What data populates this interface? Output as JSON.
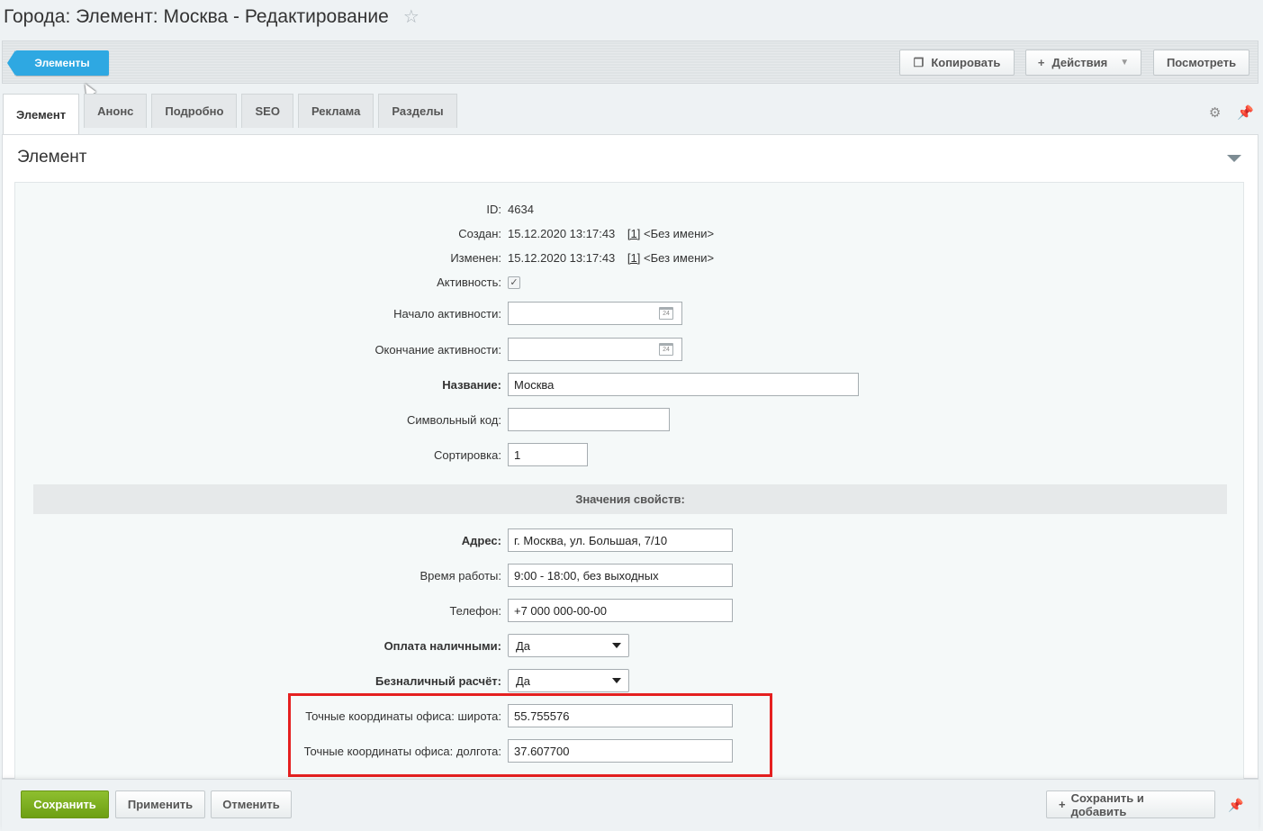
{
  "header": {
    "title": "Города: Элемент: Москва - Редактирование"
  },
  "toolbar": {
    "back_label": "Элементы",
    "copy_label": "Копировать",
    "actions_label": "Действия",
    "view_label": "Посмотреть"
  },
  "tabs": [
    {
      "label": "Элемент",
      "active": true
    },
    {
      "label": "Анонс"
    },
    {
      "label": "Подробно"
    },
    {
      "label": "SEO"
    },
    {
      "label": "Реклама"
    },
    {
      "label": "Разделы"
    }
  ],
  "section": {
    "title": "Элемент"
  },
  "fields": {
    "id": {
      "label": "ID:",
      "value": "4634"
    },
    "created": {
      "label": "Создан:",
      "value": "15.12.2020 13:17:43",
      "user_id": "[1]",
      "user_name": "<Без имени>"
    },
    "modified": {
      "label": "Изменен:",
      "value": "15.12.2020 13:17:43",
      "user_id": "[1]",
      "user_name": "<Без имени>"
    },
    "active": {
      "label": "Активность:",
      "checked": true
    },
    "active_from": {
      "label": "Начало активности:",
      "value": ""
    },
    "active_to": {
      "label": "Окончание активности:",
      "value": ""
    },
    "name": {
      "label": "Название:",
      "value": "Москва"
    },
    "code": {
      "label": "Символьный код:",
      "value": ""
    },
    "sort": {
      "label": "Сортировка:",
      "value": "1"
    }
  },
  "properties": {
    "header": "Значения свойств:",
    "address": {
      "label": "Адрес:",
      "value": "г. Москва, ул. Большая, 7/10"
    },
    "hours": {
      "label": "Время работы:",
      "value": "9:00 - 18:00, без выходных"
    },
    "phone": {
      "label": "Телефон:",
      "value": "+7 000 000-00-00"
    },
    "cash": {
      "label": "Оплата наличными:",
      "value": "Да"
    },
    "cashless": {
      "label": "Безналичный расчёт:",
      "value": "Да"
    },
    "lat": {
      "label": "Точные координаты офиса: широта:",
      "value": "55.755576"
    },
    "lon": {
      "label": "Точные координаты офиса: долгота:",
      "value": "37.607700"
    }
  },
  "footer": {
    "save_label": "Сохранить",
    "apply_label": "Применить",
    "cancel_label": "Отменить",
    "save_add_label": "Сохранить и добавить"
  },
  "colors": {
    "accent": "#2ea8e2",
    "save": "#7aad1c",
    "highlight": "#e52020"
  }
}
